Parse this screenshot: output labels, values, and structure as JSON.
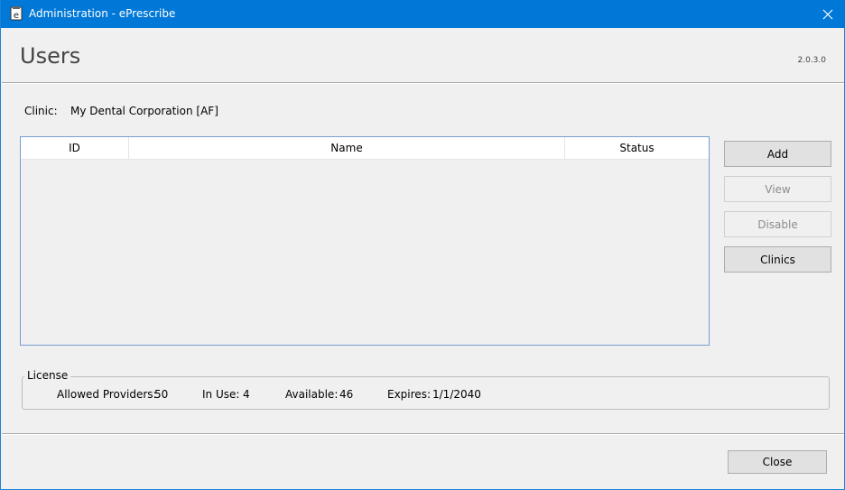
{
  "window": {
    "title": "Administration - ePrescribe",
    "titlebar_color": "#0078d7"
  },
  "header": {
    "page_title": "Users",
    "version": "2.0.3.0"
  },
  "clinic": {
    "label": "Clinic:",
    "value": "My Dental Corporation [AF]"
  },
  "grid": {
    "columns": [
      "ID",
      "Name",
      "Status"
    ],
    "rows": []
  },
  "buttons": {
    "add": "Add",
    "view": "View",
    "disable": "Disable",
    "clinics": "Clinics",
    "close": "Close"
  },
  "license": {
    "legend": "License",
    "allowed_label": "Allowed Providers:",
    "allowed_value": "50",
    "in_use_label": "In Use:",
    "in_use_value": "4",
    "available_label": "Available:",
    "available_value": "46",
    "expires_label": "Expires:",
    "expires_value": "1/1/2040"
  }
}
